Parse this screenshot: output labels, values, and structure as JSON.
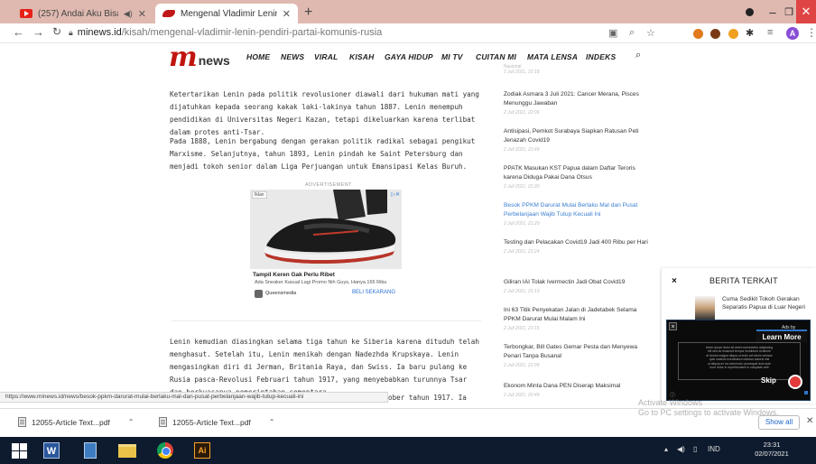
{
  "browser": {
    "tabs": [
      {
        "title": "(257) Andai Aku Bisa - Erwin",
        "active": false
      },
      {
        "title": "Mengenal Vladimir Lenin, Pendi",
        "active": true
      }
    ],
    "new_tab": "+",
    "url": {
      "host": "minews.id",
      "path": "/kisah/mengenal-vladimir-lenin-pendiri-partai-komunis-rusia"
    },
    "profile_initial": "A"
  },
  "site": {
    "logo_m": "m",
    "logo_text": "news",
    "menu": [
      "HOME",
      "NEWS",
      "VIRAL",
      "KISAH",
      "GAYA HIDUP",
      "MI TV",
      "CUITAN MI",
      "MATA LENSA",
      "INDEKS"
    ]
  },
  "article": {
    "paragraphs": [
      "Ketertarikan Lenin pada politik revolusioner diawali dari hukuman mati yang dijatuhkan kepada seorang kakak laki-lakinya tahun 1887. Lenin menempuh pendidikan di Universitas Negeri Kazan, tetapi dikeluarkan karena terlibat dalam protes anti-Tsar.",
      "Pada 1888, Lenin bergabung dengan gerakan politik radikal sebagai pengikut Marxisme. Selanjutnya, tahun 1893, Lenin pindah ke Saint Petersburg dan menjadi tokoh senior dalam Liga Perjuangan untuk Emansipasi Kelas Buruh.",
      "Lenin kemudian diasingkan selama tiga tahun ke Siberia karena dituduh telah menghasut. Setelah itu, Lenin menikah dengan Nadezhda Krupskaya. Lenin mengasingkan diri di Jerman, Britania Raya, dan Swiss. Ia baru pulang ke Rusia pasca-Revolusi Februari tahun 1917, yang menyebabkan turunnya Tsar dan berkuasanya pemerintahan sementara."
    ],
    "cutoff_tail": "ober tahun 1917. Ia"
  },
  "ad": {
    "label": "ADVERTISEMENT",
    "badge": "Iklan",
    "title": "Tampil Keren Gak Perlu Ribet",
    "subtitle": "Ada Sneaker Kasual Lagi Promo Nih Guys, Hanya 165 Ribu",
    "brand": "Queensmedia",
    "cta": "BELI SEKARANG"
  },
  "sidebar": {
    "top_fragment": "Nasional",
    "top_date": "2 Juli 2021, 22:18",
    "items": [
      {
        "headline": "Zodiak Asmara 3 Juli 2021: Cancer Merana, Pisces Menunggu Jawaban",
        "date": "2 Juli 2021, 22:06",
        "highlight": false
      },
      {
        "headline": "Antisipasi, Pemkot Surabaya Siapkan Ratusan Peti Jenazah Covid19",
        "date": "2 Juli 2021, 21:49",
        "highlight": false
      },
      {
        "headline": "PPATK Masukan KST Papua dalam Daftar Teroris karena Diduga Pakai Dana Otsus",
        "date": "2 Juli 2021, 21:30",
        "highlight": false
      },
      {
        "headline": "Besok PPKM Darurat Mulai Berlaku Mal dan Pusat Perbelanjaan Wajib Tutup Kecuali Ini",
        "date": "2 Juli 2021, 21:29",
        "highlight": true
      },
      {
        "headline": "Testing dan Pelacakan Covid19 Jadi 400 Ribu per Hari",
        "date": "2 Juli 2021, 21:24",
        "highlight": false
      },
      {
        "headline": "Giliran IAI Tolak Ivermectin Jadi Obat Covid19",
        "date": "2 Juli 2021, 21:19",
        "highlight": false
      },
      {
        "headline": "Ini 63 Titik Penyekatan Jalan di Jadetabek Selama PPKM Darurat Mulai Malam Ini",
        "date": "2 Juli 2021, 21:15",
        "highlight": false
      },
      {
        "headline": "Terbongkar, Bill Gates Gemar Pesta dan Menyewa Penari Tanpa Busana!",
        "date": "2 Juli 2021, 21:09",
        "highlight": false
      },
      {
        "headline": "Ekonom Minta Dana PEN Diserap Maksimal",
        "date": "2 Juli 2021, 20:49",
        "highlight": false
      }
    ]
  },
  "related": {
    "title": "BERITA TERKAIT",
    "close": "×",
    "item": "Cuma Sedikit Tokoh Gerakan Separatis Papua di Luar Negeri"
  },
  "video_ad": {
    "close": "×",
    "ads_by": "Ads by",
    "learn_more": "Learn More",
    "body_lines": [
      "lorem ipsum dolor sit amet consectetur adipiscing",
      "elit sed do eiusmod tempor incididunt ut labore",
      "et dolore magna aliqua ut enim ad minim veniam",
      "quis nostrud exercitation ullamco laboris nisi",
      "ut aliquip ex ea commodo consequat duis aute",
      "irure dolor in reprehenderit in voluptate velit"
    ],
    "skip": "Skip"
  },
  "status_url": "https://www.minews.id/news/besok-ppkm-darurat-mulai-berlaku-mal-dan-pusat-perbelanjaan-wajib-tutup-kecuali-ini",
  "watermark": {
    "line1": "Activate Windows",
    "line2": "Go to PC settings to activate Windows."
  },
  "downloads": {
    "files": [
      "12055-Article Text...pdf",
      "12055-Article Text...pdf"
    ],
    "show_all": "Show all"
  },
  "taskbar": {
    "word_glyph": "W",
    "ai_glyph": "Ai",
    "lang": "IND",
    "time": "23:31",
    "date": "02/07/2021"
  }
}
